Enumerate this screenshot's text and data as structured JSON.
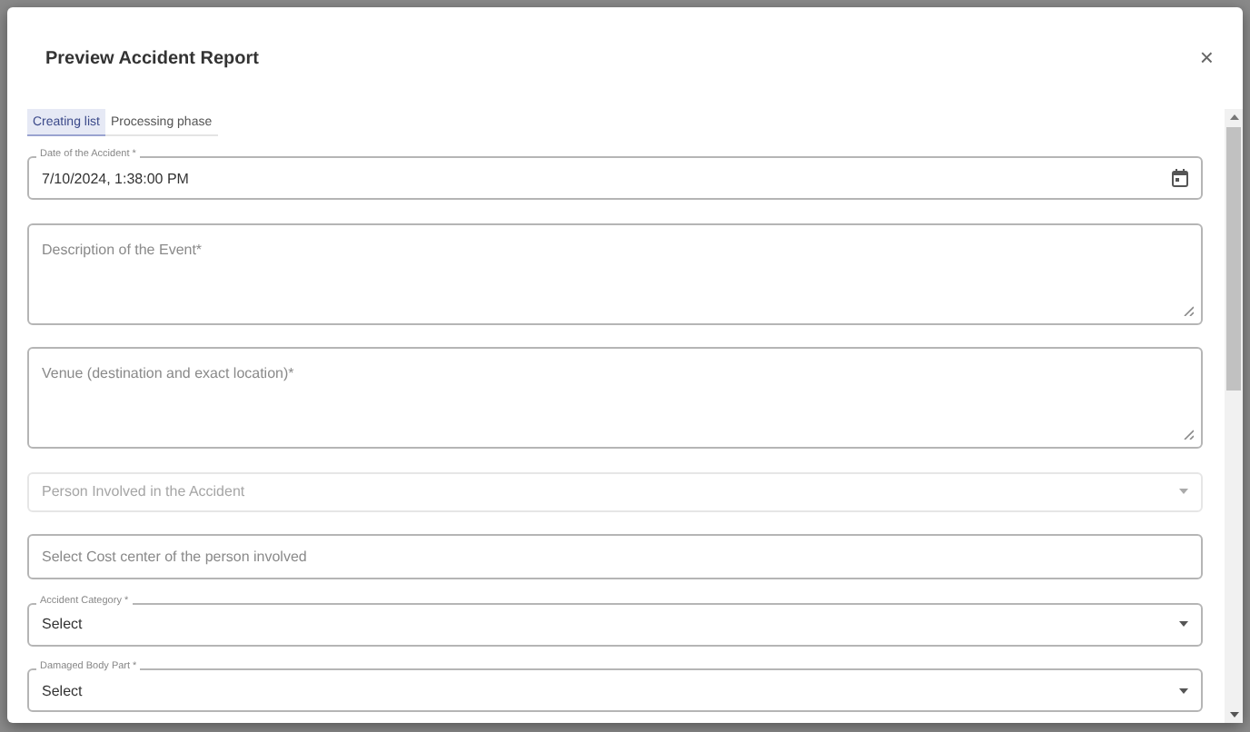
{
  "dialog": {
    "title": "Preview Accident Report",
    "close": "×"
  },
  "tabs": [
    {
      "label": "Creating list",
      "selected": true
    },
    {
      "label": "Processing phase",
      "selected": false
    }
  ],
  "fields": [
    {
      "kind": "datetime",
      "label": "Date of the Accident *",
      "value": "7/10/2024, 1:38:00 PM",
      "disabled": false
    },
    {
      "kind": "textarea",
      "placeholder": "Description of the Event*",
      "disabled": false
    },
    {
      "kind": "textarea",
      "placeholder": "Venue (destination and exact location)*",
      "disabled": false
    },
    {
      "kind": "select",
      "placeholder": "Person Involved in the Accident",
      "disabled": true
    },
    {
      "kind": "text",
      "placeholder": "Select Cost center of the person involved",
      "disabled": false
    },
    {
      "kind": "select",
      "label": "Accident Category *",
      "value": "Select",
      "disabled": false
    },
    {
      "kind": "select",
      "label": "Damaged Body Part *",
      "value": "Select",
      "disabled": false
    }
  ]
}
